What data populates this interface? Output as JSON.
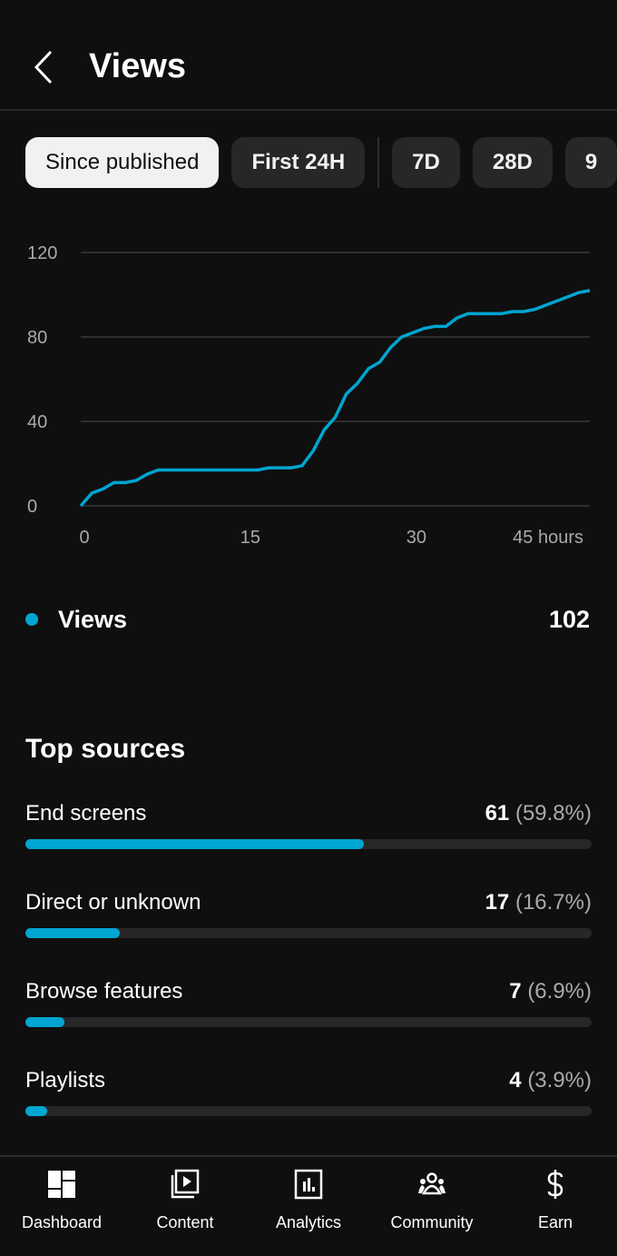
{
  "header": {
    "title": "Views",
    "back_icon": "chevron-left-icon"
  },
  "chips": [
    {
      "label": "Since published",
      "active": true
    },
    {
      "label": "First 24H"
    },
    {
      "label": "7D"
    },
    {
      "label": "28D"
    },
    {
      "label": "9"
    }
  ],
  "chart_data": {
    "type": "line",
    "xlabel": "",
    "ylabel": "",
    "x_ticks": [
      "0",
      "15",
      "30",
      "45 hours"
    ],
    "x_tick_values": [
      0,
      15,
      30,
      45
    ],
    "y_ticks": [
      "0",
      "40",
      "80",
      "120"
    ],
    "ylim": [
      0,
      120
    ],
    "xlim": [
      0,
      46
    ],
    "grid": true,
    "color": "#00a5d1",
    "x": [
      0,
      1,
      2,
      3,
      4,
      5,
      6,
      7,
      8,
      9,
      10,
      11,
      12,
      13,
      14,
      15,
      16,
      17,
      18,
      19,
      20,
      21,
      22,
      23,
      24,
      25,
      26,
      27,
      28,
      29,
      30,
      31,
      32,
      33,
      34,
      35,
      36,
      37,
      38,
      39,
      40,
      41,
      42,
      43,
      44,
      45,
      46
    ],
    "values": [
      0,
      6,
      8,
      11,
      11,
      12,
      15,
      17,
      17,
      17,
      17,
      17,
      17,
      17,
      17,
      17,
      17,
      18,
      18,
      18,
      19,
      26,
      36,
      42,
      53,
      58,
      65,
      68,
      75,
      80,
      82,
      84,
      85,
      85,
      89,
      91,
      91,
      91,
      91,
      92,
      92,
      93,
      95,
      97,
      99,
      101,
      102
    ]
  },
  "legend": {
    "label": "Views",
    "value": "102",
    "color": "#00a5d1"
  },
  "top_sources": {
    "title": "Top sources",
    "items": [
      {
        "label": "End screens",
        "count": "61",
        "pct": "(59.8%)",
        "fraction": 0.598
      },
      {
        "label": "Direct or unknown",
        "count": "17",
        "pct": "(16.7%)",
        "fraction": 0.167
      },
      {
        "label": "Browse features",
        "count": "7",
        "pct": "(6.9%)",
        "fraction": 0.069
      },
      {
        "label": "Playlists",
        "count": "4",
        "pct": "(3.9%)",
        "fraction": 0.039
      }
    ]
  },
  "nav": [
    {
      "label": "Dashboard",
      "icon": "dashboard-icon"
    },
    {
      "label": "Content",
      "icon": "content-icon"
    },
    {
      "label": "Analytics",
      "icon": "analytics-icon"
    },
    {
      "label": "Community",
      "icon": "community-icon"
    },
    {
      "label": "Earn",
      "icon": "dollar-icon"
    }
  ]
}
